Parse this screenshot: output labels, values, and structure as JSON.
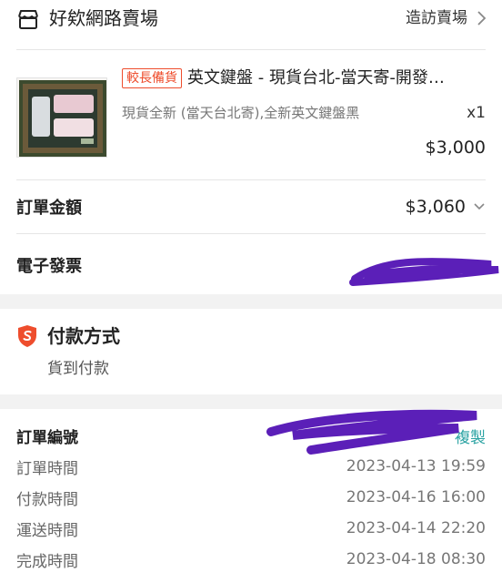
{
  "shop": {
    "name": "好欸網路賣場",
    "visit_label": "造訪賣場"
  },
  "product": {
    "badge": "較長備貨",
    "title": "英文鍵盤 - 現貨台北-當天寄-開發…",
    "variant": "現貨全新 (當天台北寄),全新英文鍵盤黑",
    "quantity": "x1",
    "price": "$3,000"
  },
  "order_total": {
    "label": "訂單金額",
    "value": "$3,060"
  },
  "invoice": {
    "label": "電子發票"
  },
  "payment": {
    "title": "付款方式",
    "method": "貨到付款"
  },
  "details": {
    "order_no_label": "訂單編號",
    "copy_label": "複製",
    "rows": [
      {
        "label": "訂單時間",
        "value": "2023-04-13 19:59"
      },
      {
        "label": "付款時間",
        "value": "2023-04-16 16:00"
      },
      {
        "label": "運送時間",
        "value": "2023-04-14 22:20"
      },
      {
        "label": "完成時間",
        "value": "2023-04-18 08:30"
      }
    ]
  },
  "colors": {
    "accent": "#ee4d2d",
    "redaction": "#5b1fb8",
    "copy_link": "#2ba3a3"
  },
  "icons": [
    "shop-icon",
    "chevron-right-icon",
    "chevron-down-icon",
    "shield-s-icon"
  ]
}
